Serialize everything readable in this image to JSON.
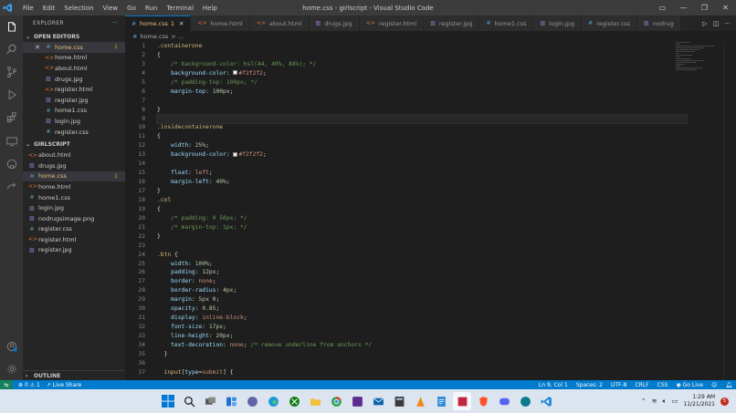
{
  "window": {
    "title": "home.css - girlscript - Visual Studio Code",
    "menu": [
      "File",
      "Edit",
      "Selection",
      "View",
      "Go",
      "Run",
      "Terminal",
      "Help"
    ]
  },
  "explorer": {
    "header": "EXPLORER",
    "open_editors_label": "OPEN EDITORS",
    "open_editors": [
      {
        "name": "home.css",
        "type": "css",
        "badge": "1",
        "active": true
      },
      {
        "name": "home.html",
        "type": "html"
      },
      {
        "name": "about.html",
        "type": "html"
      },
      {
        "name": "drugs.jpg",
        "type": "img"
      },
      {
        "name": "register.html",
        "type": "html"
      },
      {
        "name": "register.jpg",
        "type": "img"
      },
      {
        "name": "home1.css",
        "type": "css"
      },
      {
        "name": "login.jpg",
        "type": "img"
      },
      {
        "name": "register.css",
        "type": "css"
      }
    ],
    "folder_label": "GIRLSCRIPT",
    "files": [
      {
        "name": "about.html",
        "type": "html"
      },
      {
        "name": "drugs.jpg",
        "type": "img"
      },
      {
        "name": "home.css",
        "type": "css",
        "badge": "1",
        "active": true
      },
      {
        "name": "home.html",
        "type": "html"
      },
      {
        "name": "home1.css",
        "type": "css"
      },
      {
        "name": "login.jpg",
        "type": "img"
      },
      {
        "name": "nodrugsimage.png",
        "type": "img"
      },
      {
        "name": "register.css",
        "type": "css"
      },
      {
        "name": "register.html",
        "type": "html"
      },
      {
        "name": "register.jpg",
        "type": "img"
      }
    ],
    "outline_label": "OUTLINE"
  },
  "tabs": [
    {
      "name": "home.css",
      "type": "css",
      "suffix": "1",
      "active": true
    },
    {
      "name": "home.html",
      "type": "html"
    },
    {
      "name": "about.html",
      "type": "html"
    },
    {
      "name": "drugs.jpg",
      "type": "img"
    },
    {
      "name": "register.html",
      "type": "html"
    },
    {
      "name": "register.jpg",
      "type": "img"
    },
    {
      "name": "home1.css",
      "type": "css"
    },
    {
      "name": "login.jpg",
      "type": "img"
    },
    {
      "name": "register.css",
      "type": "css"
    },
    {
      "name": "nodrug",
      "type": "img"
    }
  ],
  "breadcrumb": {
    "file": "home.css",
    "rest": "> ..."
  },
  "code_lines": [
    [
      [
        "sel",
        ".containerone"
      ]
    ],
    [
      [
        "punc",
        "{"
      ]
    ],
    [
      [
        "punc",
        "    "
      ],
      [
        "com",
        "/* background-color: hsl(44, 40%, 84%); */"
      ]
    ],
    [
      [
        "punc",
        "    "
      ],
      [
        "prop",
        "background-color"
      ],
      [
        "punc",
        ": "
      ],
      [
        "sw",
        ""
      ],
      [
        "val",
        "#f2f2f2"
      ],
      [
        "punc",
        ";"
      ]
    ],
    [
      [
        "punc",
        "    "
      ],
      [
        "com",
        "/* padding-top: 100px; */"
      ]
    ],
    [
      [
        "punc",
        "    "
      ],
      [
        "prop",
        "margin-top"
      ],
      [
        "punc",
        ": "
      ],
      [
        "num",
        "100px"
      ],
      [
        "punc",
        ";"
      ]
    ],
    [],
    [
      [
        "punc",
        "}"
      ]
    ],
    [],
    [
      [
        "sel",
        ".insidecontainerone"
      ]
    ],
    [
      [
        "punc",
        "{"
      ]
    ],
    [
      [
        "punc",
        "    "
      ],
      [
        "prop",
        "width"
      ],
      [
        "punc",
        ": "
      ],
      [
        "num",
        "25%"
      ],
      [
        "punc",
        ";"
      ]
    ],
    [
      [
        "punc",
        "    "
      ],
      [
        "prop",
        "background-color"
      ],
      [
        "punc",
        ": "
      ],
      [
        "sw",
        ""
      ],
      [
        "val",
        "#f2f2f2"
      ],
      [
        "punc",
        ";"
      ]
    ],
    [],
    [
      [
        "punc",
        "    "
      ],
      [
        "prop",
        "float"
      ],
      [
        "punc",
        ": "
      ],
      [
        "val",
        "left"
      ],
      [
        "punc",
        ";"
      ]
    ],
    [
      [
        "punc",
        "    "
      ],
      [
        "prop",
        "margin-left"
      ],
      [
        "punc",
        ": "
      ],
      [
        "num",
        "40%"
      ],
      [
        "punc",
        ";"
      ]
    ],
    [
      [
        "punc",
        "}"
      ]
    ],
    [
      [
        "sel",
        ".col"
      ]
    ],
    [
      [
        "punc",
        "{"
      ]
    ],
    [
      [
        "punc",
        "    "
      ],
      [
        "com",
        "/* padding: 0 50px; */"
      ]
    ],
    [
      [
        "punc",
        "    "
      ],
      [
        "com",
        "/* margin-top: 1px; */"
      ]
    ],
    [
      [
        "punc",
        "}"
      ]
    ],
    [],
    [
      [
        "sel",
        ".btn"
      ],
      [
        "punc",
        " {"
      ]
    ],
    [
      [
        "punc",
        "    "
      ],
      [
        "prop",
        "width"
      ],
      [
        "punc",
        ": "
      ],
      [
        "num",
        "100%"
      ],
      [
        "punc",
        ";"
      ]
    ],
    [
      [
        "punc",
        "    "
      ],
      [
        "prop",
        "padding"
      ],
      [
        "punc",
        ": "
      ],
      [
        "num",
        "12px"
      ],
      [
        "punc",
        ";"
      ]
    ],
    [
      [
        "punc",
        "    "
      ],
      [
        "prop",
        "border"
      ],
      [
        "punc",
        ": "
      ],
      [
        "val",
        "none"
      ],
      [
        "punc",
        ";"
      ]
    ],
    [
      [
        "punc",
        "    "
      ],
      [
        "prop",
        "border-radius"
      ],
      [
        "punc",
        ": "
      ],
      [
        "num",
        "4px"
      ],
      [
        "punc",
        ";"
      ]
    ],
    [
      [
        "punc",
        "    "
      ],
      [
        "prop",
        "margin"
      ],
      [
        "punc",
        ": "
      ],
      [
        "num",
        "5px 0"
      ],
      [
        "punc",
        ";"
      ]
    ],
    [
      [
        "punc",
        "    "
      ],
      [
        "prop",
        "opacity"
      ],
      [
        "punc",
        ": "
      ],
      [
        "num",
        "0.85"
      ],
      [
        "punc",
        ";"
      ]
    ],
    [
      [
        "punc",
        "    "
      ],
      [
        "prop",
        "display"
      ],
      [
        "punc",
        ": "
      ],
      [
        "val",
        "inline-block"
      ],
      [
        "punc",
        ";"
      ]
    ],
    [
      [
        "punc",
        "    "
      ],
      [
        "prop",
        "font-size"
      ],
      [
        "punc",
        ": "
      ],
      [
        "num",
        "17px"
      ],
      [
        "punc",
        ";"
      ]
    ],
    [
      [
        "punc",
        "    "
      ],
      [
        "prop",
        "line-height"
      ],
      [
        "punc",
        ": "
      ],
      [
        "num",
        "20px"
      ],
      [
        "punc",
        ";"
      ]
    ],
    [
      [
        "punc",
        "    "
      ],
      [
        "prop",
        "text-decoration"
      ],
      [
        "punc",
        ": "
      ],
      [
        "val",
        "none"
      ],
      [
        "punc",
        "; "
      ],
      [
        "com",
        "/* remove underline from anchors */"
      ]
    ],
    [
      [
        "punc",
        "  }"
      ]
    ],
    [],
    [
      [
        "punc",
        "  "
      ],
      [
        "sel",
        "input"
      ],
      [
        "punc",
        "["
      ],
      [
        "prop",
        "type"
      ],
      [
        "punc",
        "="
      ],
      [
        "val",
        "submit"
      ],
      [
        "punc",
        "] {"
      ]
    ]
  ],
  "highlight_line": 9,
  "status": {
    "errors": "0",
    "warnings": "1",
    "live_share": "Live Share",
    "position": "Ln 9, Col 1",
    "spaces": "Spaces: 2",
    "encoding": "UTF-8",
    "eol": "CRLF",
    "language": "CSS",
    "go_live": "Go Live"
  },
  "clock": {
    "time": "1:29 AM",
    "date": "11/21/2021"
  },
  "colors": {
    "accent": "#007acc",
    "css": "#519aba",
    "html": "#e37933",
    "img": "#a074c4"
  }
}
